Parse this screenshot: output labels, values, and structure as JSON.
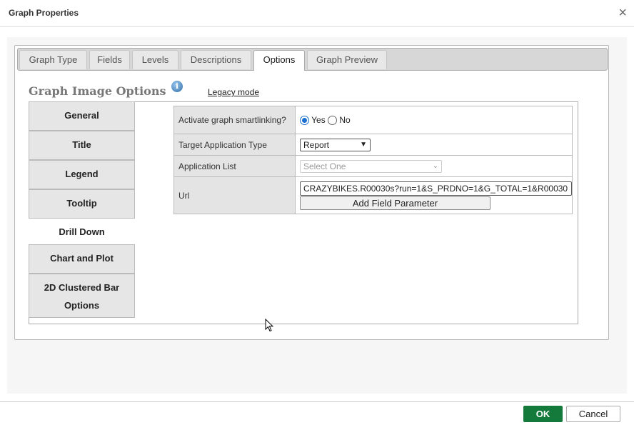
{
  "dialog": {
    "title": "Graph Properties",
    "close_icon": "close-icon"
  },
  "tabs": [
    {
      "label": "Graph Type",
      "active": false
    },
    {
      "label": "Fields",
      "active": false
    },
    {
      "label": "Levels",
      "active": false
    },
    {
      "label": "Descriptions",
      "active": false
    },
    {
      "label": "Options",
      "active": true
    },
    {
      "label": "Graph Preview",
      "active": false
    }
  ],
  "section": {
    "title": "Graph Image Options",
    "info_icon": "info-icon",
    "legacy_link": "Legacy mode"
  },
  "nav": [
    {
      "label": "General"
    },
    {
      "label": "Title"
    },
    {
      "label": "Legend"
    },
    {
      "label": "Tooltip"
    },
    {
      "label": "Drill Down",
      "selected": true
    },
    {
      "label": "Chart and Plot"
    },
    {
      "label_line1": "2D Clustered Bar",
      "label_line2": "Options"
    }
  ],
  "properties": {
    "smartlinking": {
      "label": "Activate graph smartlinking?",
      "yes": "Yes",
      "no": "No",
      "value": "Yes"
    },
    "target_type": {
      "label": "Target Application Type",
      "value": "Report"
    },
    "app_list": {
      "label": "Application List",
      "value": "Select One"
    },
    "url": {
      "label": "Url",
      "value": "CRAZYBIKES.R00030s?run=1&S_PRDNO=1&G_TOTAL=1&R00030",
      "button": "Add Field Parameter"
    }
  },
  "footer": {
    "ok": "OK",
    "cancel": "Cancel",
    "ok_color": "#137a3c"
  }
}
